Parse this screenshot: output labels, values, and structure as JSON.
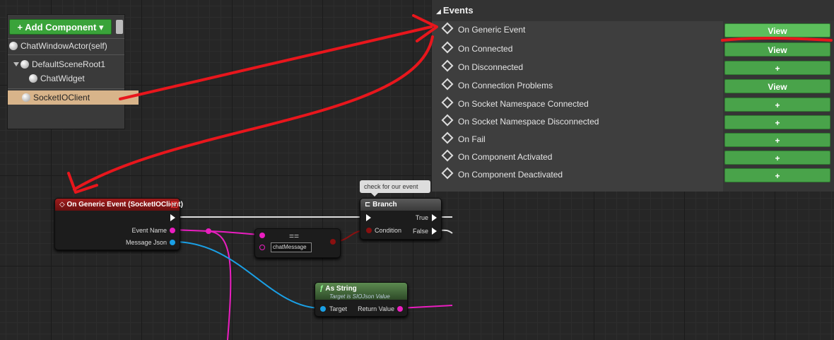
{
  "components": {
    "add_button": "+ Add Component ▾",
    "items": [
      "ChatWindowActor(self)",
      "DefaultSceneRoot1",
      "ChatWidget",
      "SocketIOClient"
    ]
  },
  "events": {
    "header": "Events",
    "items": [
      {
        "label": "On Generic Event",
        "button": "View"
      },
      {
        "label": "On Connected",
        "button": "View"
      },
      {
        "label": "On Disconnected",
        "button": "+"
      },
      {
        "label": "On Connection Problems",
        "button": "View"
      },
      {
        "label": "On Socket Namespace Connected",
        "button": "+"
      },
      {
        "label": "On Socket Namespace Disconnected",
        "button": "+"
      },
      {
        "label": "On Fail",
        "button": "+"
      },
      {
        "label": "On Component Activated",
        "button": "+"
      },
      {
        "label": "On Component Deactivated",
        "button": "+"
      }
    ]
  },
  "graph": {
    "comment": "check for our event",
    "event_node": {
      "title": "On Generic Event (SocketIOClient)",
      "pin_event_name": "Event Name",
      "pin_message_json": "Message Json"
    },
    "equals_node": {
      "symbol": "==",
      "input_value": "chatMessage"
    },
    "branch_node": {
      "title": "Branch",
      "condition": "Condition",
      "true": "True",
      "false": "False"
    },
    "asstring_node": {
      "title": "As String",
      "subtitle": "Target is SIOJson Value",
      "target": "Target",
      "return": "Return Value"
    }
  },
  "colors": {
    "accent_green": "#49a34a",
    "annotation_red": "#e8161c",
    "string_pin": "#ea1ec0",
    "object_pin": "#1aa0e6"
  }
}
